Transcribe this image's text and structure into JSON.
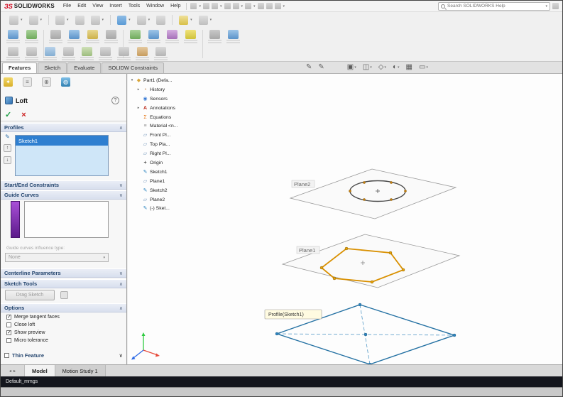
{
  "colors": {
    "selection_blue": "#2f7fd0",
    "guide_purple": "#8a2be2",
    "hexagon_orange": "#d99000",
    "sketch_blue": "#2471a3",
    "check_green": "#1f9e46",
    "cross_red": "#cc2222",
    "header_navy": "#24456e"
  },
  "icons": {
    "check": "✓",
    "cross": "×",
    "chevron_up": "∧",
    "chevron_down": "∨",
    "dropdown": "▾",
    "help": "?",
    "up_arrow": "↑",
    "down_arrow": "↓",
    "left_nav": "◂",
    "right_nav": "▸"
  },
  "menubar": {
    "logo": "SOLIDWORKS",
    "logo_mark": "ЗS",
    "menus": [
      {
        "label": "File"
      },
      {
        "label": "Edit"
      },
      {
        "label": "View"
      },
      {
        "label": "Insert"
      },
      {
        "label": "Tools"
      },
      {
        "label": "Window"
      },
      {
        "label": "Help"
      }
    ],
    "search": {
      "placeholder": "Search SOLIDWORKS Help"
    }
  },
  "ribbon_tabs": [
    {
      "label": "Features"
    },
    {
      "label": "Sketch"
    },
    {
      "label": "Evaluate"
    },
    {
      "label": "SOLIDW Constraints"
    }
  ],
  "property_panel": {
    "title": "Loft",
    "profiles": {
      "header": "Profiles",
      "items": [
        {
          "label": "Sketch1"
        }
      ]
    },
    "start_end_constraints": {
      "header": "Start/End Constraints"
    },
    "guide_curves": {
      "header": "Guide Curves",
      "influence_label": "Guide curves influence type:",
      "influence_value": "None"
    },
    "centerline_parameters": {
      "header": "Centerline Parameters"
    },
    "sketch_tools": {
      "header": "Sketch Tools",
      "drag_sketch_label": "Drag Sketch"
    },
    "options": {
      "header": "Options",
      "checkboxes": [
        {
          "label": "Merge tangent faces",
          "mark": "✓"
        },
        {
          "label": "Close loft",
          "mark": ""
        },
        {
          "label": "Show preview",
          "mark": "✓"
        },
        {
          "label": "Micro tolerance",
          "mark": ""
        }
      ]
    },
    "thin_feature": {
      "label": "Thin Feature",
      "mark": ""
    }
  },
  "feature_tree": {
    "items": [
      {
        "label": "Part1 (Defa..."
      },
      {
        "label": "History"
      },
      {
        "label": "Sensors"
      },
      {
        "label": "Annotations"
      },
      {
        "label": "Equations"
      },
      {
        "label": "Material <n..."
      },
      {
        "label": "Front Pl..."
      },
      {
        "label": "Top Pla..."
      },
      {
        "label": "Right Pl..."
      },
      {
        "label": "Origin"
      },
      {
        "label": "Sketch1"
      },
      {
        "label": "Plane1"
      },
      {
        "label": "Sketch2"
      },
      {
        "label": "Plane2"
      },
      {
        "label": "(-) Sket..."
      }
    ]
  },
  "viewport": {
    "plane2_label": "Plane2",
    "plane1_label": "Plane1",
    "tooltip": "Profile(Sketch1)"
  },
  "bottom_tabs": {
    "items": [
      {
        "label": "Model"
      },
      {
        "label": "Motion Study 1"
      }
    ]
  },
  "status_bar": {
    "left": "Default_mmgs"
  }
}
